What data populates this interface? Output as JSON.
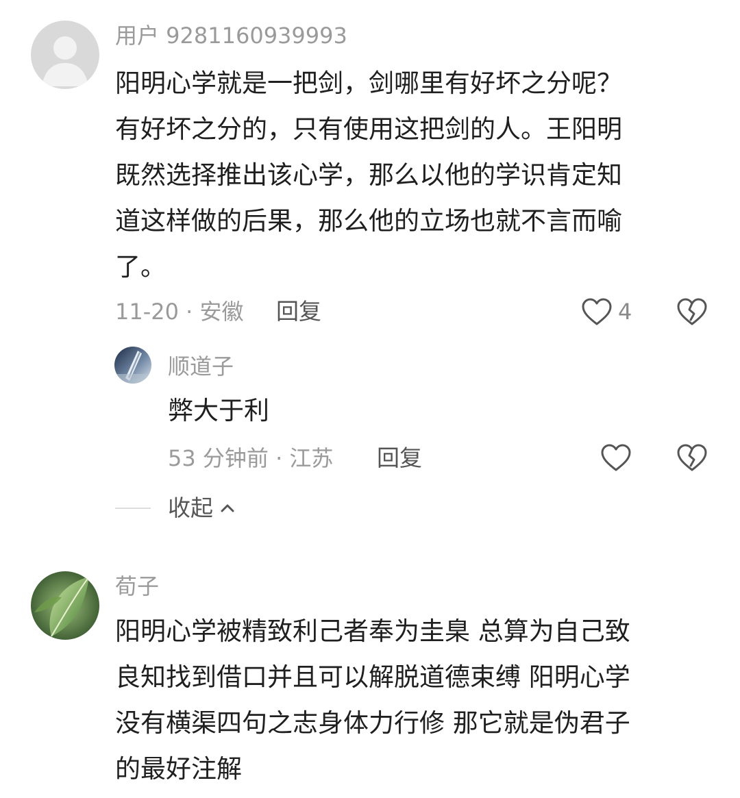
{
  "comments": [
    {
      "username": "用户 9281160939993",
      "lines": [
        "阳明心学就是一把剑，剑哪里有好坏之分呢？",
        "有好坏之分的，只有使用这把剑的人。王阳明",
        "既然选择推出该心学，那么以他的学识肯定知",
        "道这样做的后果，那么他的立场也就不言而喻",
        "了。"
      ],
      "meta": "11-20 · 安徽",
      "reply_label": "回复",
      "like_count": "4",
      "like_icon": "heart-outline-icon",
      "dislike_icon": "broken-heart-icon",
      "replies": [
        {
          "username": "顺道子",
          "text": "弊大于利",
          "meta": "53 分钟前 · 江苏",
          "reply_label": "回复",
          "like_icon": "heart-outline-icon",
          "dislike_icon": "broken-heart-icon"
        }
      ],
      "collapse_label": "收起",
      "collapse_icon": "chevron-up-icon"
    },
    {
      "username": "荀子",
      "lines": [
        "阳明心学被精致利己者奉为圭臬 总算为自己致",
        "良知找到借口并且可以解脱道德束缚 阳明心学",
        "没有横渠四句之志身体力行修 那它就是伪君子",
        "的最好注解"
      ]
    }
  ],
  "colors": {
    "text_primary": "#1f1f1f",
    "text_secondary": "#9a9a9a",
    "icon": "#555555",
    "background": "#ffffff"
  }
}
